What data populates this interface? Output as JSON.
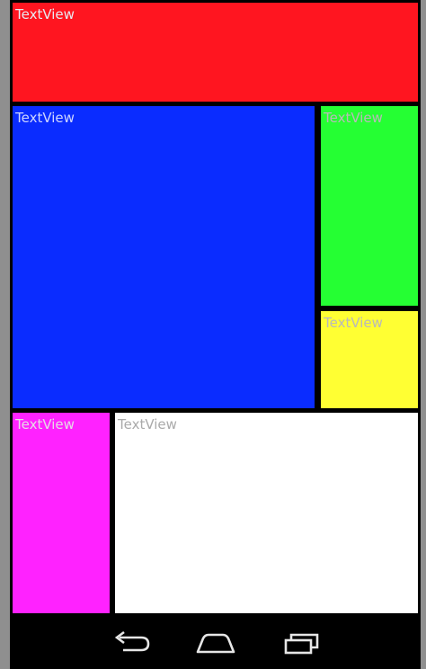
{
  "colors": {
    "red": "#ff1520",
    "blue": "#0a2cff",
    "green": "#25ff33",
    "yellow": "#ffff33",
    "pink": "#ff22ff",
    "white": "#ffffff",
    "divider": "#000000",
    "label_light": "#cfd6ff",
    "label_dark": "#aaaaaa"
  },
  "textviews": {
    "red": "TextView",
    "blue": "TextView",
    "green": "TextView",
    "yellow": "TextView",
    "pink": "TextView",
    "white": "TextView"
  },
  "navbar": {
    "back_icon": "back-icon",
    "home_icon": "home-icon",
    "recents_icon": "recents-icon"
  }
}
